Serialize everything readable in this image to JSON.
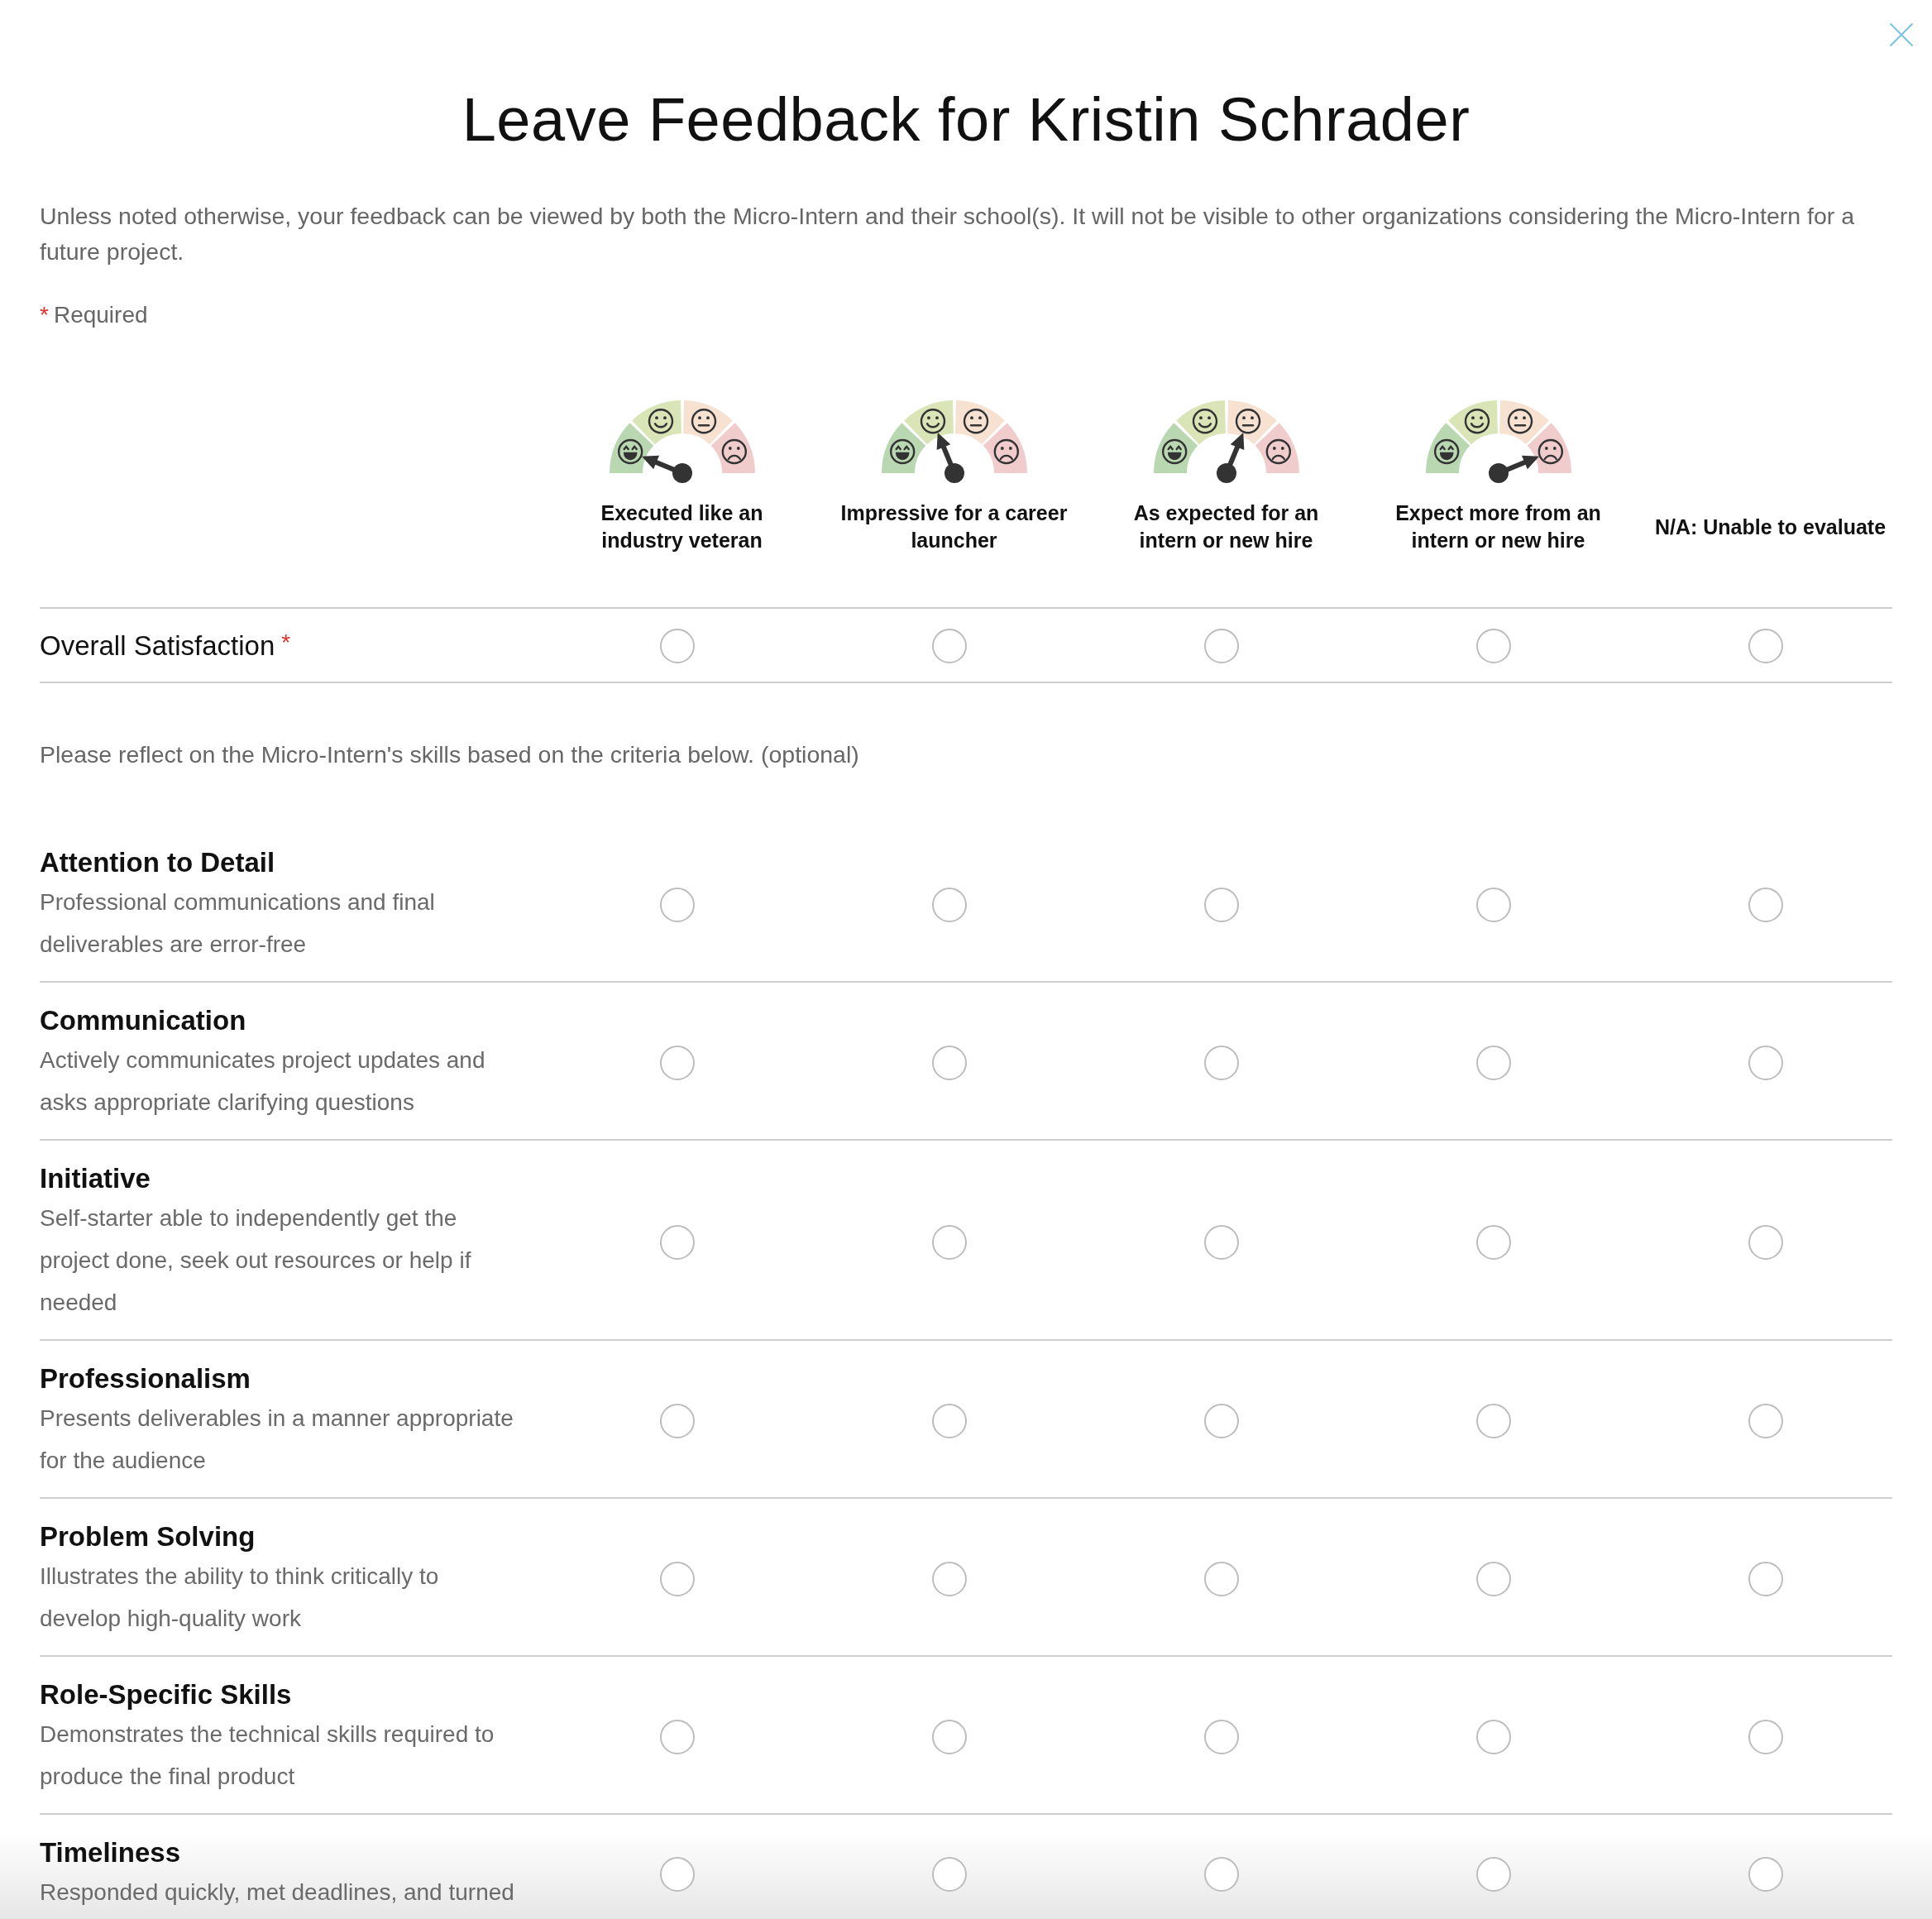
{
  "dialog": {
    "title": "Leave Feedback for Kristin Schrader",
    "intro": "Unless noted otherwise, your feedback can be viewed by both the Micro-Intern and their school(s). It will not be visible to other organizations considering the Micro-Intern for a future project.",
    "required_legend": {
      "mark": "*",
      "text": "Required"
    }
  },
  "rating_columns": [
    {
      "kind": "gauge",
      "label": "Executed like an industry veteran"
    },
    {
      "kind": "gauge",
      "label": "Impressive for a career launcher"
    },
    {
      "kind": "gauge",
      "label": "As expected for an intern or new hire"
    },
    {
      "kind": "gauge",
      "label": "Expect more from an intern or new hire"
    },
    {
      "kind": "text",
      "label": "N/A: Unable to evaluate"
    }
  ],
  "overall": {
    "label": "Overall Satisfaction",
    "required_mark": "*",
    "options": [
      {
        "selected": false
      },
      {
        "selected": false
      },
      {
        "selected": false
      },
      {
        "selected": false
      },
      {
        "selected": false
      }
    ]
  },
  "skills_note": "Please reflect on the Micro-Intern's skills based on the criteria below. (optional)",
  "skills": [
    {
      "title": "Attention to Detail",
      "description": "Professional communications and final deliverables are error-free",
      "options": [
        {
          "selected": false
        },
        {
          "selected": false
        },
        {
          "selected": false
        },
        {
          "selected": false
        },
        {
          "selected": false
        }
      ]
    },
    {
      "title": "Communication",
      "description": "Actively communicates project updates and asks appropriate clarifying questions",
      "options": [
        {
          "selected": false
        },
        {
          "selected": false
        },
        {
          "selected": false
        },
        {
          "selected": false
        },
        {
          "selected": false
        }
      ]
    },
    {
      "title": "Initiative",
      "description": "Self-starter able to independently get the project done, seek out resources or help if needed",
      "options": [
        {
          "selected": false
        },
        {
          "selected": false
        },
        {
          "selected": false
        },
        {
          "selected": false
        },
        {
          "selected": false
        }
      ]
    },
    {
      "title": "Professionalism",
      "description": "Presents deliverables in a manner appropriate for the audience",
      "options": [
        {
          "selected": false
        },
        {
          "selected": false
        },
        {
          "selected": false
        },
        {
          "selected": false
        },
        {
          "selected": false
        }
      ]
    },
    {
      "title": "Problem Solving",
      "description": "Illustrates the ability to think critically to develop high-quality work",
      "options": [
        {
          "selected": false
        },
        {
          "selected": false
        },
        {
          "selected": false
        },
        {
          "selected": false
        },
        {
          "selected": false
        }
      ]
    },
    {
      "title": "Role-Specific Skills",
      "description": "Demonstrates the technical skills required to produce the final product",
      "options": [
        {
          "selected": false
        },
        {
          "selected": false
        },
        {
          "selected": false
        },
        {
          "selected": false
        },
        {
          "selected": false
        }
      ]
    },
    {
      "title": "Timeliness",
      "description": "Responded quickly, met deadlines, and turned",
      "options": [
        {
          "selected": false
        },
        {
          "selected": false
        },
        {
          "selected": false
        },
        {
          "selected": false
        },
        {
          "selected": false
        }
      ]
    }
  ]
}
